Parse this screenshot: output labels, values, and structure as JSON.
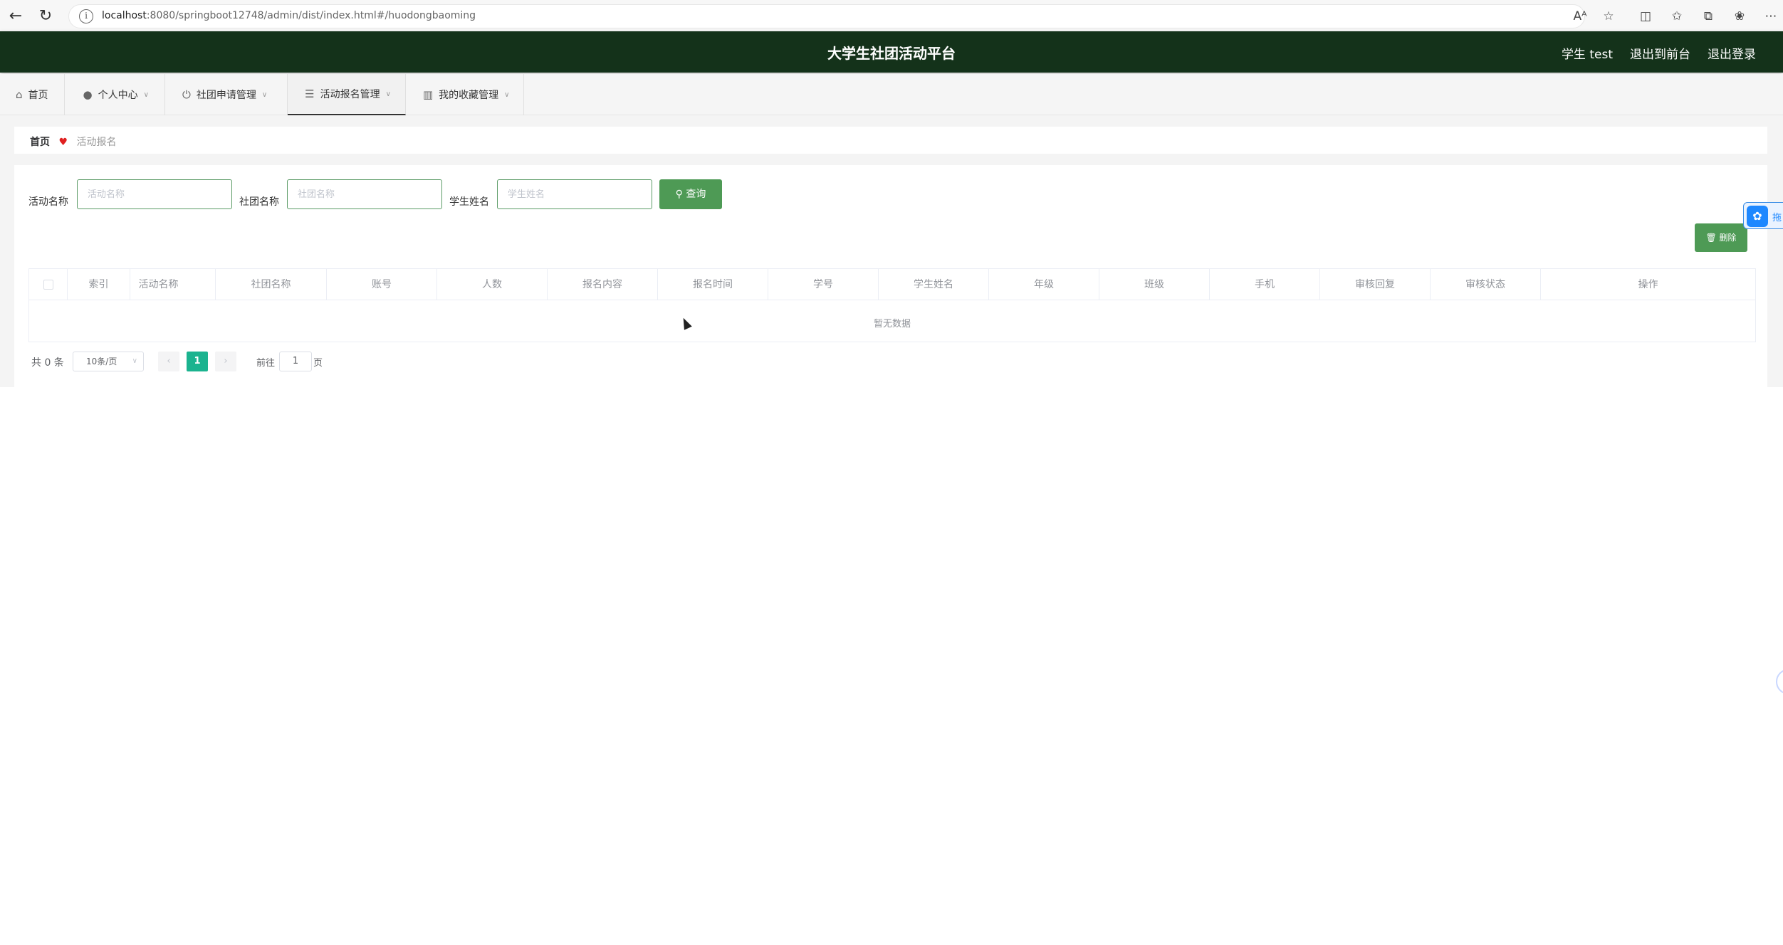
{
  "browser": {
    "url_host": "localhost",
    "url_path": ":8080/springboot12748/admin/dist/index.html#/huodongbaoming"
  },
  "header": {
    "title": "大学生社团活动平台",
    "user": "学生 test",
    "back_front": "退出到前台",
    "logout": "退出登录",
    "background_color": "#14321a"
  },
  "menu": {
    "items": [
      {
        "label": "首页",
        "icon": "home-icon"
      },
      {
        "label": "个人中心",
        "icon": "user-icon"
      },
      {
        "label": "社团申请管理",
        "icon": "power-icon"
      },
      {
        "label": "活动报名管理",
        "icon": "sliders-icon"
      },
      {
        "label": "我的收藏管理",
        "icon": "bookmark-icon"
      }
    ]
  },
  "breadcrumb": {
    "home": "首页",
    "current": "活动报名"
  },
  "search": {
    "label1": "活动名称",
    "placeholder1": "活动名称",
    "label2": "社团名称",
    "placeholder2": "社团名称",
    "label3": "学生姓名",
    "placeholder3": "学生姓名",
    "query_label": "查询",
    "delete_label": "删除",
    "accent_color": "#4e9a55"
  },
  "table": {
    "columns": [
      "索引",
      "活动名称",
      "社团名称",
      "账号",
      "人数",
      "报名内容",
      "报名时间",
      "学号",
      "学生姓名",
      "年级",
      "班级",
      "手机",
      "审核回复",
      "审核状态",
      "操作"
    ],
    "empty_text": "暂无数据"
  },
  "pagination": {
    "total": "共 0 条",
    "page_size": "10条/页",
    "current_page": "1",
    "goto_prefix": "前往",
    "goto_value": "1",
    "goto_suffix": "页",
    "active_color": "#1bb38f"
  },
  "float_widget": {
    "text": "拖"
  }
}
